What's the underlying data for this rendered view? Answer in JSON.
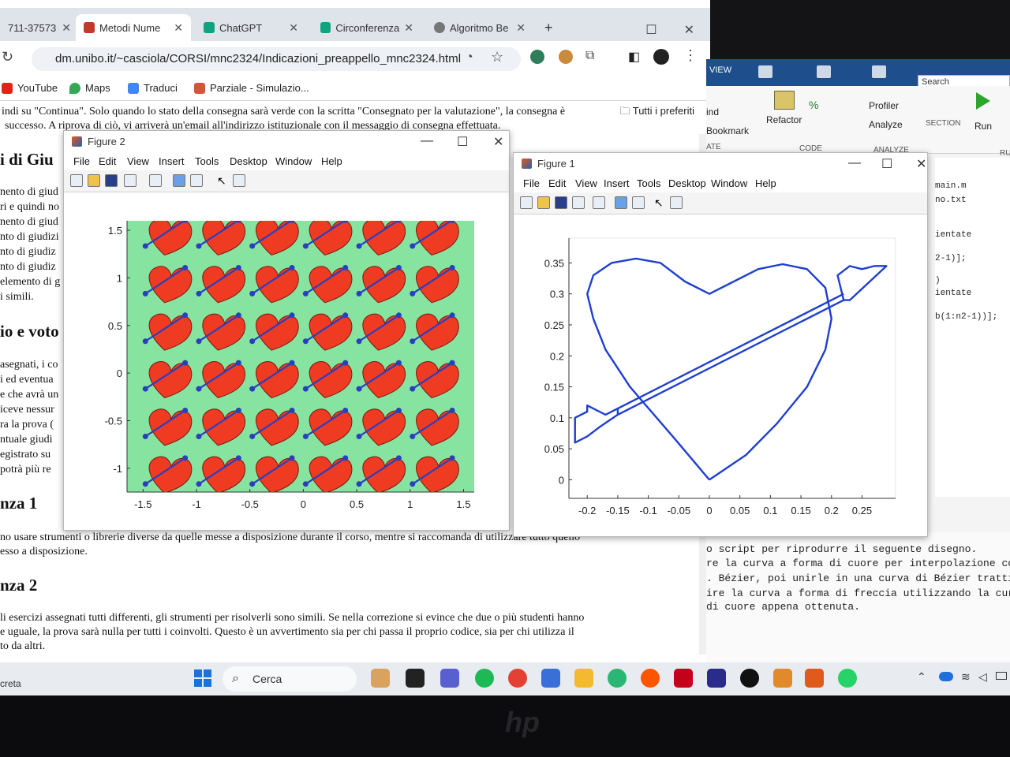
{
  "browser": {
    "tabs": [
      {
        "label": "711-37573"
      },
      {
        "label": "Metodi Nume"
      },
      {
        "label": "ChatGPT"
      },
      {
        "label": "Circonferenza"
      },
      {
        "label": "Algoritmo Be"
      }
    ],
    "new_tab": "+",
    "url": "dm.unibo.it/~casciola/CORSI/mnc2324/Indicazioni_preappello_mnc2324.html",
    "bookmarks": [
      "YouTube",
      "Maps",
      "Traduci",
      "Parziale - Simulazio..."
    ],
    "favorites_folder": "Tutti i preferiti",
    "page_lines_top": [
      "indi su \"Continua\". Solo quando lo stato della consegna sarà verde con la scritta \"Consegnato per la valutazione\", la consegna è",
      "successo. A riprova di ciò, vi arriverà un'email all'indirizzo istituzionale con il messaggio di consegna effettuata."
    ],
    "page_heading_1": "i di Giu",
    "page_left_lines_1": [
      "nento di giud",
      "ri e quindi no",
      "nento di giud",
      "nto di giudizi",
      "nto di giudiz",
      "nto di giudiz",
      "elemento di g",
      "i simili."
    ],
    "page_heading_2": "io e voto",
    "page_left_lines_2": [
      "asegnati, i co",
      "i ed eventua",
      "e che avrà un",
      "iceve nessur",
      "ra la prova (",
      "ntuale giudi",
      "egistrato su",
      "potrà più re"
    ],
    "page_heading_3": "nza 1",
    "page_para_3": [
      "no usare strumenti o librerie diverse da quelle messe a disposizione durante il corso, mentre si raccomanda di utilizzare tutto quello",
      "esso a disposizione."
    ],
    "page_heading_4": "nza 2",
    "page_para_4": [
      "li esercizi assegnati tutti differenti, gli strumenti per risolverli sono simili. Se nella correzione si evince che due o più studenti hanno",
      "e uguale, la prova sarà nulla per tutti i coinvolti. Questo è un avvertimento sia per chi passa il proprio codice, sia per chi utilizza il",
      "to da altri."
    ]
  },
  "matlab": {
    "tab_view": "VIEW",
    "search_placeholder": "Search Documentation",
    "ribbon": {
      "find": "ind",
      "bookmark": "Bookmark",
      "refactor": "Refactor",
      "profiler": "Profiler",
      "analyze": "Analyze",
      "section": "SECTION",
      "run": "Run",
      "group_code": "CODE",
      "group_analyze": "ANALYZE",
      "group_ate": "ATE",
      "group_ru": "RU"
    },
    "editor_tabs": [
      "main.m",
      "no.txt"
    ],
    "code_lines": [
      "ientate",
      "2-1)];",
      ")",
      "ientate",
      "b(1:n2-1))];"
    ],
    "command_lines": [
      "o script per riprodurre il seguente disegno.",
      "re la curva a forma di cuore per interpolazione con du",
      ". Bézier, poi unirle in una curva di Bézier tratti.",
      "ire la curva a forma di freccia utilizzando la curva",
      " di cuore appena ottenuta."
    ]
  },
  "figure2": {
    "title": "Figure 2",
    "menus": [
      "File",
      "Edit",
      "View",
      "Insert",
      "Tools",
      "Desktop",
      "Window",
      "Help"
    ],
    "colors": {
      "background": "#86e3a0",
      "heart": "#ef3b22",
      "arrow": "#2a3fbf"
    },
    "chart_data": {
      "type": "scatter",
      "description_kind": "tiled pattern",
      "x_ticks": [
        "-1.5",
        "-1",
        "-0.5",
        "0",
        "0.5",
        "1",
        "1.5"
      ],
      "y_ticks": [
        "-1",
        "-0.5",
        "0",
        "0.5",
        "1",
        "1.5"
      ],
      "xlim": [
        -1.65,
        1.6
      ],
      "ylim": [
        -1.25,
        1.6
      ],
      "tile_centers_x": [
        -1.25,
        -0.75,
        -0.25,
        0.25,
        0.75,
        1.25
      ],
      "tile_centers_y": [
        1.45,
        0.95,
        0.45,
        -0.05,
        -0.55,
        -1.05
      ]
    }
  },
  "figure1": {
    "title": "Figure 1",
    "menus": [
      "File",
      "Edit",
      "View",
      "Insert",
      "Tools",
      "Desktop",
      "Window",
      "Help"
    ],
    "colors": {
      "line": "#1f3fd0"
    },
    "chart_data": {
      "type": "line",
      "x_ticks": [
        "-0.2",
        "-0.15",
        "-0.1",
        "-0.05",
        "0",
        "0.05",
        "0.1",
        "0.15",
        "0.2",
        "0.25"
      ],
      "y_ticks": [
        "0",
        "0.05",
        "0.1",
        "0.15",
        "0.2",
        "0.25",
        "0.3",
        "0.35"
      ],
      "xlim": [
        -0.23,
        0.305
      ],
      "ylim": [
        -0.03,
        0.39
      ],
      "series": [
        {
          "x": [
            0,
            -0.06,
            -0.13,
            -0.17,
            -0.19,
            -0.2,
            -0.19,
            -0.16,
            -0.12,
            -0.08,
            -0.04,
            0,
            0.04,
            0.08,
            0.12,
            0.16,
            0.19,
            0.2,
            0.19,
            0.16,
            0.11,
            0.06,
            0
          ],
          "y": [
            0,
            0.07,
            0.15,
            0.21,
            0.26,
            0.3,
            0.33,
            0.35,
            0.357,
            0.35,
            0.32,
            0.3,
            0.32,
            0.34,
            0.348,
            0.34,
            0.31,
            0.26,
            0.21,
            0.15,
            0.09,
            0.04,
            0
          ]
        },
        {
          "x": [
            -0.15,
            0.22
          ],
          "y": [
            0.105,
            0.29
          ]
        },
        {
          "x": [
            -0.15,
            0.22
          ],
          "y": [
            0.115,
            0.3
          ]
        },
        {
          "x": [
            0.22,
            0.21,
            0.23,
            0.25,
            0.27,
            0.29,
            0.23,
            0.22
          ],
          "y": [
            0.29,
            0.33,
            0.345,
            0.34,
            0.345,
            0.345,
            0.29,
            0.29
          ]
        },
        {
          "x": [
            -0.15,
            -0.18,
            -0.2,
            -0.22,
            -0.22,
            -0.2,
            -0.2,
            -0.17,
            -0.15,
            -0.15
          ],
          "y": [
            0.105,
            0.085,
            0.07,
            0.06,
            0.1,
            0.11,
            0.12,
            0.105,
            0.115,
            0.105
          ]
        }
      ]
    }
  },
  "taskbar": {
    "left_text": "creta",
    "search": "Cerca"
  }
}
